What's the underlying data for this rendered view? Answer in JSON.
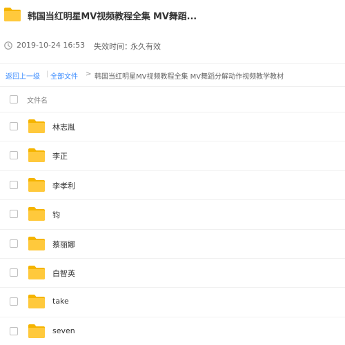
{
  "header": {
    "title": "韩国当红明星MV视频教程全集 MV舞蹈...",
    "icon": "folder-icon"
  },
  "meta": {
    "icon": "clock-icon",
    "date": "2019-10-24 16:53",
    "expire_label": "失效时间：",
    "expire_value": "永久有效"
  },
  "breadcrumb": {
    "back": "返回上一级",
    "separator": "|",
    "all_files": "全部文件",
    "arrow": ">",
    "current": "韩国当红明星MV视频教程全集 MV舞蹈分解动作视频教学教材"
  },
  "list": {
    "column_name": "文件名",
    "items": [
      {
        "name": "林志胤"
      },
      {
        "name": "李正"
      },
      {
        "name": "李孝利"
      },
      {
        "name": "钧"
      },
      {
        "name": "蔡丽娜"
      },
      {
        "name": "白智英"
      },
      {
        "name": "take"
      },
      {
        "name": "seven"
      }
    ]
  },
  "colors": {
    "link": "#3b8cff",
    "folder": "#ffc93c",
    "folder_tab": "#f5b400"
  }
}
